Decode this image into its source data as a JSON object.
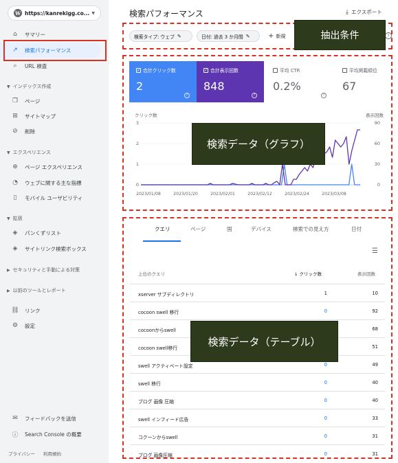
{
  "sidebar": {
    "property": "https://kanrekigg.co...",
    "items": [
      {
        "label": "サマリー",
        "icon": "home-icon"
      },
      {
        "label": "検索パフォーマンス",
        "icon": "trending-up-icon"
      },
      {
        "label": "URL 検査",
        "icon": "search-icon"
      },
      {
        "label": "ページ",
        "icon": "pages-icon"
      },
      {
        "label": "サイトマップ",
        "icon": "sitemap-icon"
      },
      {
        "label": "削除",
        "icon": "eye-off-icon"
      },
      {
        "label": "ページ エクスペリエンス",
        "icon": "circle-plus-icon"
      },
      {
        "label": "ウェブに関する主な指標",
        "icon": "gauge-icon"
      },
      {
        "label": "モバイル ユーザビリティ",
        "icon": "phone-icon"
      },
      {
        "label": "パンくずリスト",
        "icon": "layers-icon"
      },
      {
        "label": "サイトリンク検索ボックス",
        "icon": "layers-icon"
      },
      {
        "label": "リンク",
        "icon": "links-icon"
      },
      {
        "label": "設定",
        "icon": "gear-icon"
      },
      {
        "label": "フィードバックを送信",
        "icon": "feedback-icon"
      },
      {
        "label": "Search Console の概要",
        "icon": "info-icon"
      }
    ],
    "sections": [
      "インデックス作成",
      "エクスペリエンス",
      "拡張",
      "セキュリティと手動による対策",
      "以前のツールとレポート"
    ],
    "footer": [
      "プライバシー",
      "利用規約"
    ]
  },
  "header": {
    "title": "検索パフォーマンス",
    "export": "エクスポート"
  },
  "filters": {
    "chips": [
      "検索タイプ: ウェブ",
      "日付: 過去 3 か月間"
    ],
    "new": "新規"
  },
  "annotations": [
    "抽出条件",
    "検索データ（グラフ）",
    "検索データ（テーブル）"
  ],
  "cards": [
    {
      "label": "合計クリック数",
      "value": "2",
      "color": "#4285f4",
      "active": true
    },
    {
      "label": "合計表示回数",
      "value": "848",
      "color": "#5e35b1",
      "active": true
    },
    {
      "label": "平均 CTR",
      "value": "0.2%",
      "active": false
    },
    {
      "label": "平均掲載順位",
      "value": "67",
      "active": false
    }
  ],
  "chart_data": {
    "type": "line",
    "y_left_label": "クリック数",
    "y_right_label": "表示回数",
    "y_left_ticks": [
      "3",
      "2",
      "1",
      "0"
    ],
    "y_right_ticks": [
      "90",
      "60",
      "30",
      "0"
    ],
    "x_labels": [
      "2023/01/08",
      "2023/01/20",
      "2023/02/01",
      "2023/02/12",
      "2023/02/24",
      "2023/03/08"
    ],
    "ylim_left": [
      0,
      3
    ],
    "ylim_right": [
      0,
      90
    ],
    "series": [
      {
        "name": "合計クリック数",
        "color": "#4285f4",
        "axis": "left",
        "values": [
          0,
          0,
          0,
          0,
          0,
          0,
          0,
          0,
          0,
          0,
          0,
          0,
          0,
          0,
          0,
          0,
          0,
          0,
          0,
          0,
          0,
          0,
          0,
          0,
          0,
          0,
          0,
          0,
          0,
          0,
          0,
          0,
          0,
          0,
          0,
          0,
          0,
          0,
          0,
          0,
          0,
          0,
          0,
          0,
          0,
          0,
          0,
          0,
          0,
          0,
          0,
          1,
          0,
          0,
          0,
          0,
          0,
          0,
          0,
          0,
          0,
          0,
          0,
          0,
          0,
          0,
          0,
          0,
          0,
          0,
          0,
          0,
          0,
          0,
          0,
          1,
          0,
          0,
          0
        ]
      },
      {
        "name": "合計表示回数",
        "color": "#5e35b1",
        "axis": "right",
        "values": [
          0,
          0,
          0,
          0,
          0,
          0,
          0,
          0,
          0,
          0,
          0,
          0,
          0,
          0,
          0,
          0,
          0,
          0,
          0,
          0,
          0,
          0,
          0,
          0,
          0,
          2,
          0,
          0,
          0,
          0,
          0,
          0,
          0,
          2,
          1,
          0,
          0,
          0,
          0,
          0,
          2,
          0,
          0,
          0,
          0,
          2,
          0,
          0,
          3,
          5,
          0,
          30,
          0,
          0,
          0,
          8,
          8,
          15,
          20,
          25,
          20,
          30,
          25,
          40,
          35,
          50,
          45,
          48,
          55,
          40,
          65,
          60,
          55,
          60,
          70,
          30,
          50,
          65,
          80,
          80
        ]
      }
    ]
  },
  "table": {
    "tabs": [
      "クエリ",
      "ページ",
      "国",
      "デバイス",
      "検索での見え方",
      "日付"
    ],
    "headers": [
      "上位のクエリ",
      "クリック数",
      "表示回数"
    ],
    "rows": [
      {
        "query": "xserver サブディレクトリ",
        "clicks": "1",
        "impressions": "10"
      },
      {
        "query": "cocoon swell 移行",
        "clicks": "0",
        "impressions": "92"
      },
      {
        "query": "cocoonからswell",
        "clicks": "0",
        "impressions": "68"
      },
      {
        "query": "cocoon swell移行",
        "clicks": "0",
        "impressions": "51"
      },
      {
        "query": "swell アクティベート設定",
        "clicks": "0",
        "impressions": "49"
      },
      {
        "query": "swell 移行",
        "clicks": "0",
        "impressions": "40"
      },
      {
        "query": "ブログ 画像 圧縮",
        "clicks": "0",
        "impressions": "40"
      },
      {
        "query": "swell インフィード広告",
        "clicks": "0",
        "impressions": "33"
      },
      {
        "query": "コクーンからswell",
        "clicks": "0",
        "impressions": "31"
      },
      {
        "query": "ブログ 画像圧縮",
        "clicks": "0",
        "impressions": "31"
      }
    ]
  }
}
